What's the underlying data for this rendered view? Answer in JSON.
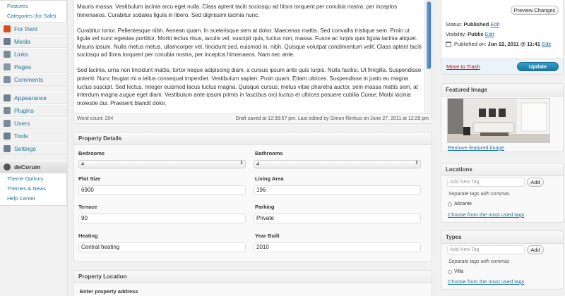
{
  "sidebar": {
    "submenu": [
      "Features",
      "Categories (for Sale)"
    ],
    "menu_items": [
      {
        "label": "For Rent",
        "icon": "pushpin-icon",
        "color": "#d54e21"
      },
      {
        "label": "Media",
        "icon": "media-icon",
        "color": "#6b7b8c"
      },
      {
        "label": "Links",
        "icon": "links-icon",
        "color": "#7a8a99"
      },
      {
        "label": "Pages",
        "icon": "pages-icon",
        "color": "#8a98a6"
      },
      {
        "label": "Comments",
        "icon": "comments-icon",
        "color": "#7f8f9e"
      }
    ],
    "menu_items_2": [
      {
        "label": "Appearance",
        "icon": "appearance-icon",
        "color": "#6f7f8f"
      },
      {
        "label": "Plugins",
        "icon": "plugins-icon",
        "color": "#7a8a99"
      },
      {
        "label": "Users",
        "icon": "users-icon",
        "color": "#7a8a99"
      },
      {
        "label": "Tools",
        "icon": "tools-icon",
        "color": "#6f7f8f"
      },
      {
        "label": "Settings",
        "icon": "settings-icon",
        "color": "#6f7f8f"
      }
    ],
    "theme_menu": {
      "label": "deCorum",
      "items": [
        "Theme Options",
        "Themes & News",
        "Help Center"
      ]
    }
  },
  "editor": {
    "paragraphs": [
      "Mauris massa. Vestibulum lacinia arcu eget nulla. Class aptent taciti sociosqu ad litora torquent per conubia nostra, per inceptos himenaeos. Curabitur sodales ligula in libero. Sed dignissim lacinia nunc.",
      "Curabitur tortor. Pellentesque nibh. Aenean quam. In scelerisque sem at dolor. Maecenas mattis. Sed convallis tristique sem. Proin ut ligula vel nunc egestas porttitor. Morbi lectus risus, iaculis vel, suscipit quis, luctus non, massa. Fusce ac turpis quis ligula lacinia aliquet. Mauris ipsum. Nulla metus metus, ullamcorper vel, tincidunt sed, euismod in, nibh. Quisque volutpat condimentum velit. Class aptent taciti sociosqu ad litora torquent per conubia nostra, per inceptos himenaeos. Nam nec ante.",
      "Sed lacinia, urna non tincidunt mattis, tortor neque adipiscing diam, a cursus ipsum ante quis turpis. Nulla facilisi. Ut fringilla. Suspendisse potenti. Nunc feugiat mi a tellus consequat imperdiet. Vestibulum sapien. Proin quam. Etiam ultrices. Suspendisse in justo eu magna luctus suscipit. Sed lectus. Integer euismod lacus luctus magna. Quisque cursus, metus vitae pharetra auctor, sem massa mattis sem, at interdum magna augue eget diam. Vestibulum ante ipsum primis in faucibus orci luctus et ultrices posuere cubilia Curae; Morbi lacinia molestie dui. Praesent blandit dolor."
    ],
    "word_count": "Word count: 204",
    "draft_status": "Draft saved at 12:39:57 pm. Last edited by Simon Rimkus on June 27, 2011 at 12:29 pm"
  },
  "property_details": {
    "title": "Property Details",
    "bedrooms_label": "Bedrooms",
    "bedrooms_value": "4",
    "bathrooms_label": "Bathrooms",
    "bathrooms_value": "4",
    "plot_size_label": "Plot Size",
    "plot_size_value": "6900",
    "living_area_label": "Living Area",
    "living_area_value": "196",
    "terrace_label": "Terrace",
    "terrace_value": "90",
    "parking_label": "Parking",
    "parking_value": "Private",
    "heating_label": "Heating",
    "heating_value": "Central heating",
    "year_built_label": "Year Built",
    "year_built_value": "2010"
  },
  "property_location": {
    "title": "Property Location",
    "address_label": "Enter property address"
  },
  "publish": {
    "preview_label": "Preview Changes",
    "status_label": "Status:",
    "status_value": "Published",
    "visibility_label": "Visibility:",
    "visibility_value": "Public",
    "published_label": "Published on:",
    "published_value": "Jun 22, 2011 @ 11:41",
    "edit_label": "Edit",
    "trash_label": "Move to Trash",
    "update_label": "Update"
  },
  "featured_image": {
    "title": "Featured Image",
    "remove_label": "Remove featured image"
  },
  "locations": {
    "title": "Locations",
    "placeholder": "Add New Tag",
    "add_label": "Add",
    "hint": "Separate tags with commas",
    "tag": "Alicante",
    "choose_label": "Choose from the most used tags"
  },
  "types": {
    "title": "Types",
    "placeholder": "Add New Tag",
    "add_label": "Add",
    "hint": "Separate tags with commas",
    "tag": "Villa",
    "choose_label": "Choose from the most used tags"
  },
  "colors": {
    "link": "#21759b",
    "primary_button": "#21759b",
    "trash": "#bc0b0b"
  }
}
